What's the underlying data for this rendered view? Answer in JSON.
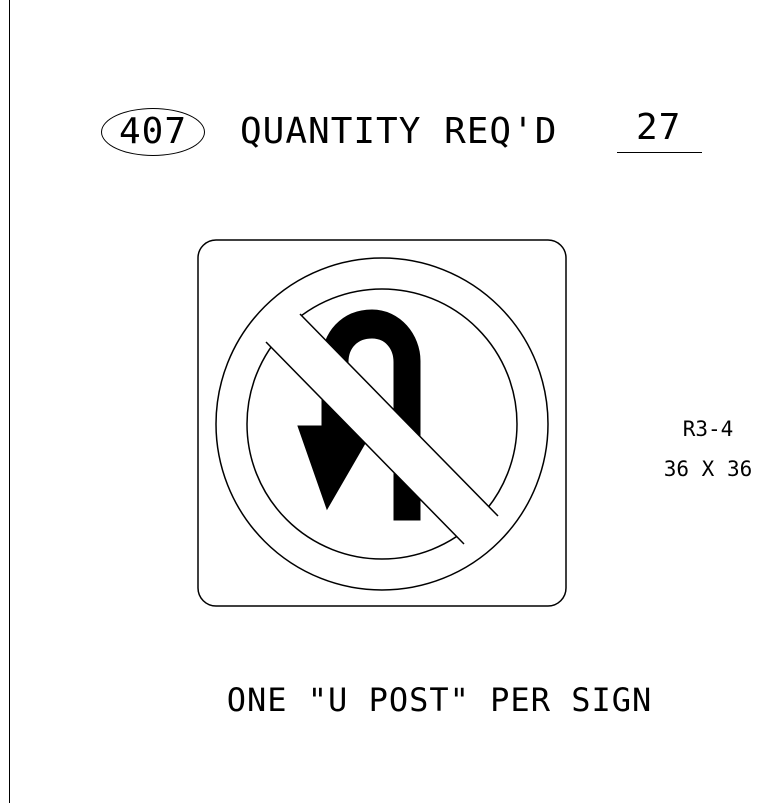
{
  "header": {
    "item_number": "407",
    "quantity_label": "QUANTITY REQ'D",
    "quantity_value": "27"
  },
  "sign": {
    "code": "R3-4",
    "size": "36 X 36",
    "symbol": "no-u-turn-icon",
    "colors": {
      "outline": "#000000",
      "background": "#ffffff",
      "symbol_fill": "#000000"
    }
  },
  "note": {
    "text": "ONE \"U POST\" PER SIGN"
  }
}
